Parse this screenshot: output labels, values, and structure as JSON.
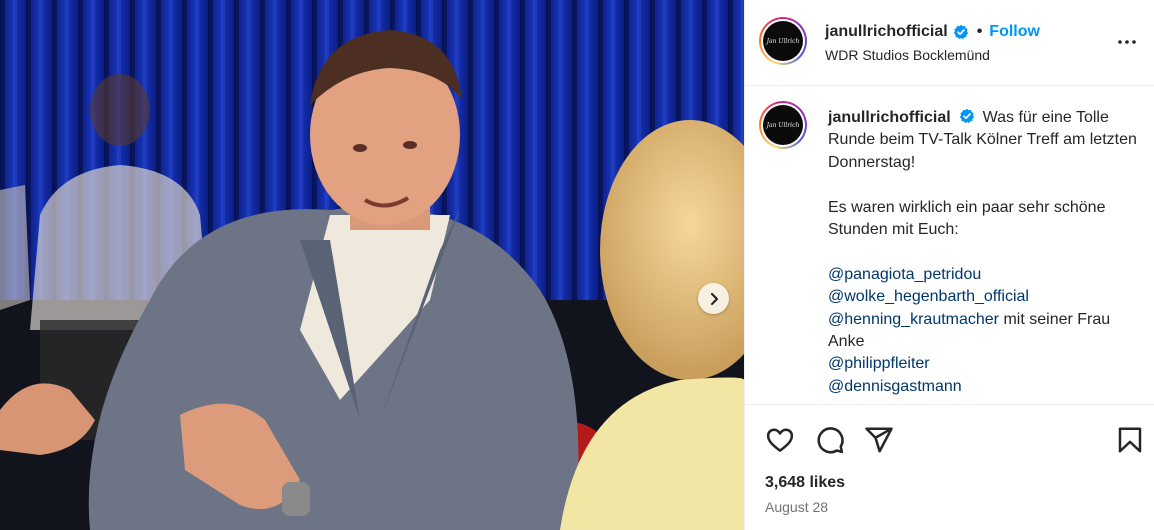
{
  "post": {
    "username": "janullrichofficial",
    "verified": true,
    "separator": "•",
    "follow_label": "Follow",
    "location": "WDR Studios Bocklemünd",
    "avatar_text": "Jan Ullrich"
  },
  "caption": {
    "username": "janullrichofficial",
    "line1": "Was für eine Tolle Runde beim TV-Talk Kölner Treff am letzten Donnerstag!",
    "line2": "Es waren wirklich ein paar sehr schöne Stunden mit Euch:",
    "mentions": [
      {
        "handle": "@panagiota_petridou",
        "suffix": ""
      },
      {
        "handle": "@wolke_hegenbarth_official",
        "suffix": ""
      },
      {
        "handle": "@henning_krautmacher",
        "suffix": " mit seiner Frau Anke"
      },
      {
        "handle": "@philippfleiter",
        "suffix": ""
      },
      {
        "handle": "@dennisgastmann",
        "suffix": ""
      }
    ]
  },
  "engagement": {
    "likes": "3,648 likes",
    "date": "August 28"
  },
  "icons": {
    "like": "heart-icon",
    "comment": "comment-icon",
    "share": "share-icon",
    "save": "bookmark-icon",
    "more": "more-horizontal-icon",
    "next": "chevron-right-icon"
  },
  "colors": {
    "link": "#00376b",
    "follow": "#0095f6",
    "verified": "#0095f6",
    "backdrop": "#0d1f7a"
  }
}
